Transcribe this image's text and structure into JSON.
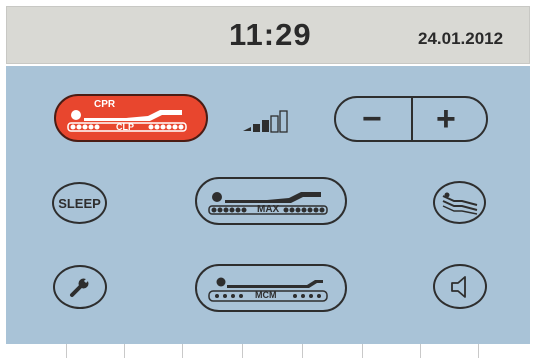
{
  "header": {
    "time": "11:29",
    "date": "24.01.2012"
  },
  "buttons": {
    "cpr": {
      "top_label": "CPR",
      "mattress_label": "CLP",
      "color": "#e8462e"
    },
    "minus_label": "−",
    "plus_label": "+",
    "sleep_label": "SLEEP",
    "max_label": "MAX",
    "mcm_label": "MCM"
  },
  "signal": {
    "level_filled": 3,
    "level_total": 5
  },
  "icons": [
    "cpr-bed-icon",
    "signal-strength-icon",
    "sleep-icon",
    "max-bed-icon",
    "flat-bed-icon",
    "wrench-icon",
    "mcm-bed-icon",
    "speaker-icon"
  ],
  "colors": {
    "panel": "#a9c3d7",
    "header": "#d9d9d4",
    "cpr_active": "#e8462e"
  }
}
